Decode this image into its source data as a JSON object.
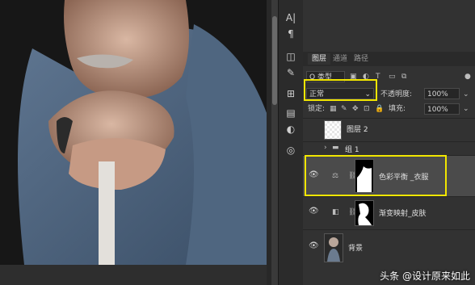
{
  "tool_icons": [
    "type-tool-icon",
    "paragraph-icon",
    "3d-icon",
    "brush-settings-icon",
    "clone-source-icon",
    "properties-icon",
    "adjustments-icon",
    "libraries-icon"
  ],
  "tabs": [
    {
      "label": "图层",
      "active": true
    },
    {
      "label": "通道",
      "active": false
    },
    {
      "label": "路径",
      "active": false
    }
  ],
  "filter": {
    "label": "Q 类型"
  },
  "blend": {
    "mode": "正常",
    "opacity_label": "不透明度:",
    "opacity_value": "100%"
  },
  "lock": {
    "label": "锁定:",
    "fill_label": "填充:",
    "fill_value": "100%"
  },
  "layers": [
    {
      "name": "图层 2",
      "type": "pixel",
      "visible": false
    },
    {
      "name": "组 1",
      "type": "group",
      "visible": false
    },
    {
      "name": "色彩平衡 _衣服",
      "type": "adjustment",
      "visible": true,
      "selected": true
    },
    {
      "name": "渐变映射_皮肤",
      "type": "adjustment",
      "visible": true
    },
    {
      "name": "背景",
      "type": "pixel",
      "visible": true
    }
  ],
  "watermark": "头条 @设计原来如此",
  "colors": {
    "highlight": "#f2e600",
    "panel": "#323232",
    "selected_row": "#4b4b4b"
  }
}
